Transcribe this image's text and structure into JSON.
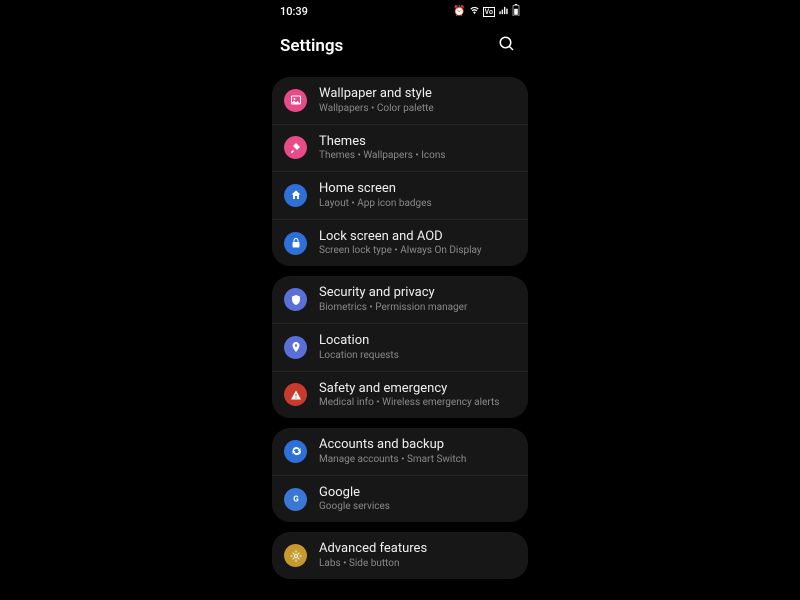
{
  "status": {
    "time": "10:39"
  },
  "header": {
    "title": "Settings"
  },
  "groups": [
    {
      "rows": [
        {
          "id": "wallpaper",
          "title": "Wallpaper and style",
          "sub": "Wallpapers  •  Color palette",
          "color": "#e84c88",
          "icon": "picture"
        },
        {
          "id": "themes",
          "title": "Themes",
          "sub": "Themes  •  Wallpapers  •  Icons",
          "color": "#e84c88",
          "icon": "brush"
        },
        {
          "id": "home",
          "title": "Home screen",
          "sub": "Layout  •  App icon badges",
          "color": "#2f6fd8",
          "icon": "home"
        },
        {
          "id": "lock",
          "title": "Lock screen and AOD",
          "sub": "Screen lock type  •  Always On Display",
          "color": "#2f6fd8",
          "icon": "lock"
        }
      ]
    },
    {
      "rows": [
        {
          "id": "security",
          "title": "Security and privacy",
          "sub": "Biometrics  •  Permission manager",
          "color": "#5b6fd8",
          "icon": "shield"
        },
        {
          "id": "location",
          "title": "Location",
          "sub": "Location requests",
          "color": "#5b6fd8",
          "icon": "pin"
        },
        {
          "id": "safety",
          "title": "Safety and emergency",
          "sub": "Medical info  •  Wireless emergency alerts",
          "color": "#c83a2e",
          "icon": "alert"
        }
      ]
    },
    {
      "rows": [
        {
          "id": "accounts",
          "title": "Accounts and backup",
          "sub": "Manage accounts  •  Smart Switch",
          "color": "#2f6fd8",
          "icon": "sync"
        },
        {
          "id": "google",
          "title": "Google",
          "sub": "Google services",
          "color": "#3b78d6",
          "icon": "google"
        }
      ]
    },
    {
      "rows": [
        {
          "id": "advanced",
          "title": "Advanced features",
          "sub": "Labs  •  Side button",
          "color": "#c79a2f",
          "icon": "gear"
        }
      ]
    }
  ]
}
